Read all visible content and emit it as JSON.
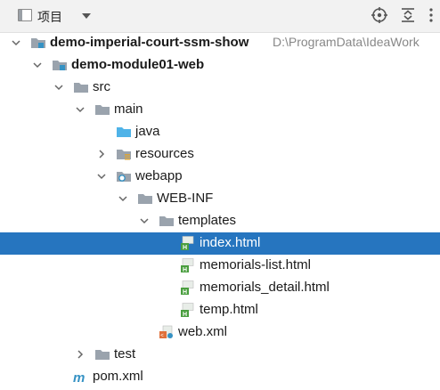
{
  "toolbar": {
    "title": "项目",
    "icons": [
      "project-view-icon",
      "dropdown-icon",
      "locate-icon",
      "expand-collapse-icon",
      "more-icon"
    ]
  },
  "tree": [
    {
      "label": "demo-imperial-court-ssm-show",
      "path": "D:\\ProgramData\\IdeaWork",
      "icon": "module-folder-icon",
      "expanded": true,
      "bold": true
    },
    {
      "label": "demo-module01-web",
      "icon": "module-folder-icon",
      "expanded": true,
      "bold": true
    },
    {
      "label": "src",
      "icon": "folder-icon",
      "expanded": true
    },
    {
      "label": "main",
      "icon": "folder-icon",
      "expanded": true
    },
    {
      "label": "java",
      "icon": "source-folder-icon"
    },
    {
      "label": "resources",
      "icon": "resources-folder-icon",
      "expanded": false
    },
    {
      "label": "webapp",
      "icon": "web-folder-icon",
      "expanded": true
    },
    {
      "label": "WEB-INF",
      "icon": "folder-icon",
      "expanded": true
    },
    {
      "label": "templates",
      "icon": "folder-icon",
      "expanded": true
    },
    {
      "label": "index.html",
      "icon": "html-file-icon",
      "selected": true
    },
    {
      "label": "memorials-list.html",
      "icon": "html-file-icon"
    },
    {
      "label": "memorials_detail.html",
      "icon": "html-file-icon"
    },
    {
      "label": "temp.html",
      "icon": "html-file-icon"
    },
    {
      "label": "web.xml",
      "icon": "xml-file-icon"
    },
    {
      "label": "test",
      "icon": "folder-icon",
      "expanded": false
    },
    {
      "label": "pom.xml",
      "icon": "maven-file-icon"
    }
  ]
}
